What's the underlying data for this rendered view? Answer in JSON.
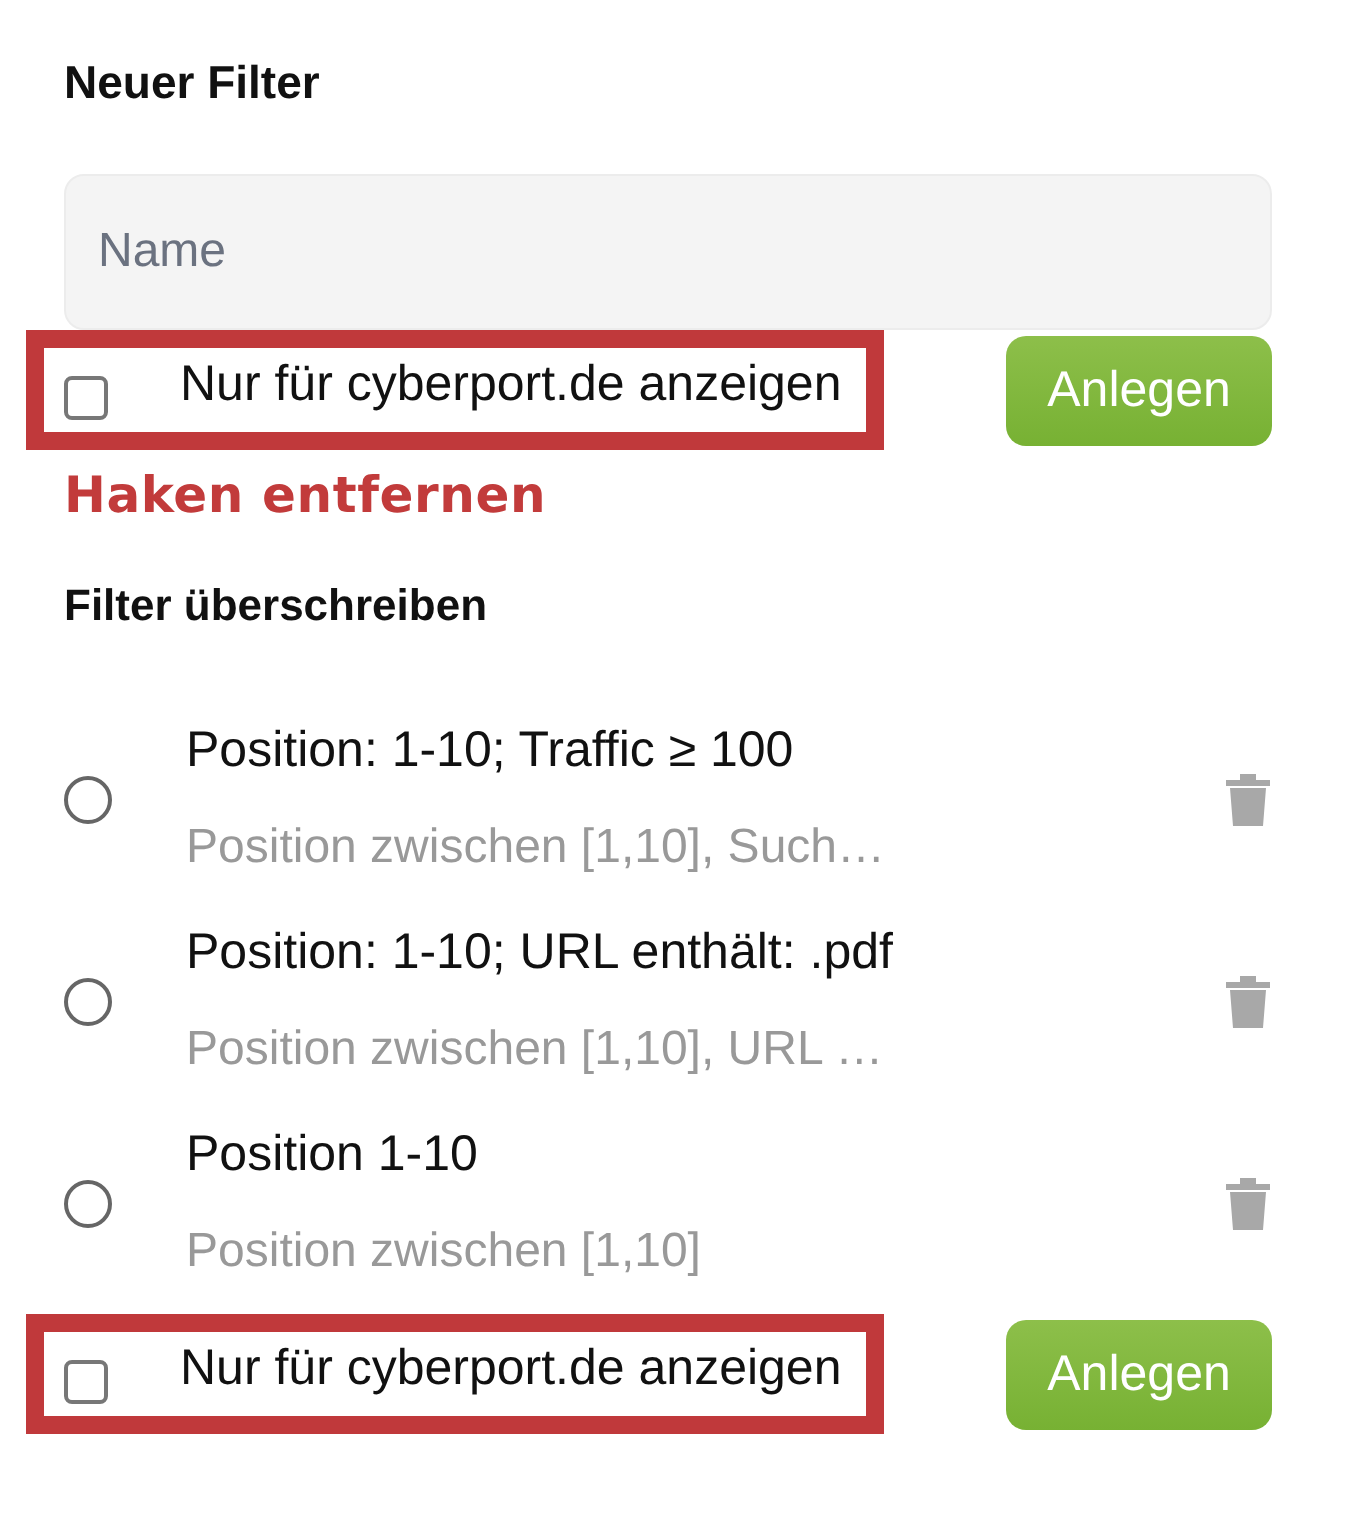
{
  "title": "Neuer Filter",
  "name_field": {
    "placeholder": "Name"
  },
  "top_option": {
    "label": "Nur für cyberport.de anzeigen",
    "checked": false,
    "highlighted": true,
    "button": "Anlegen"
  },
  "annotation": "Haken entfernen",
  "section_title": "Filter überschreiben",
  "filters": [
    {
      "title": "Position: 1-10; Traffic ≥ 100",
      "subtitle": "Position zwischen [1,10], Such…",
      "selected": false
    },
    {
      "title": "Position: 1-10; URL enthält: .pdf",
      "subtitle": "Position zwischen [1,10], URL …",
      "selected": false
    },
    {
      "title": "Position 1-10",
      "subtitle": "Position zwischen [1,10]",
      "selected": false
    }
  ],
  "bottom_option": {
    "label": "Nur für cyberport.de anzeigen",
    "checked": false,
    "highlighted": true,
    "button": "Anlegen"
  }
}
